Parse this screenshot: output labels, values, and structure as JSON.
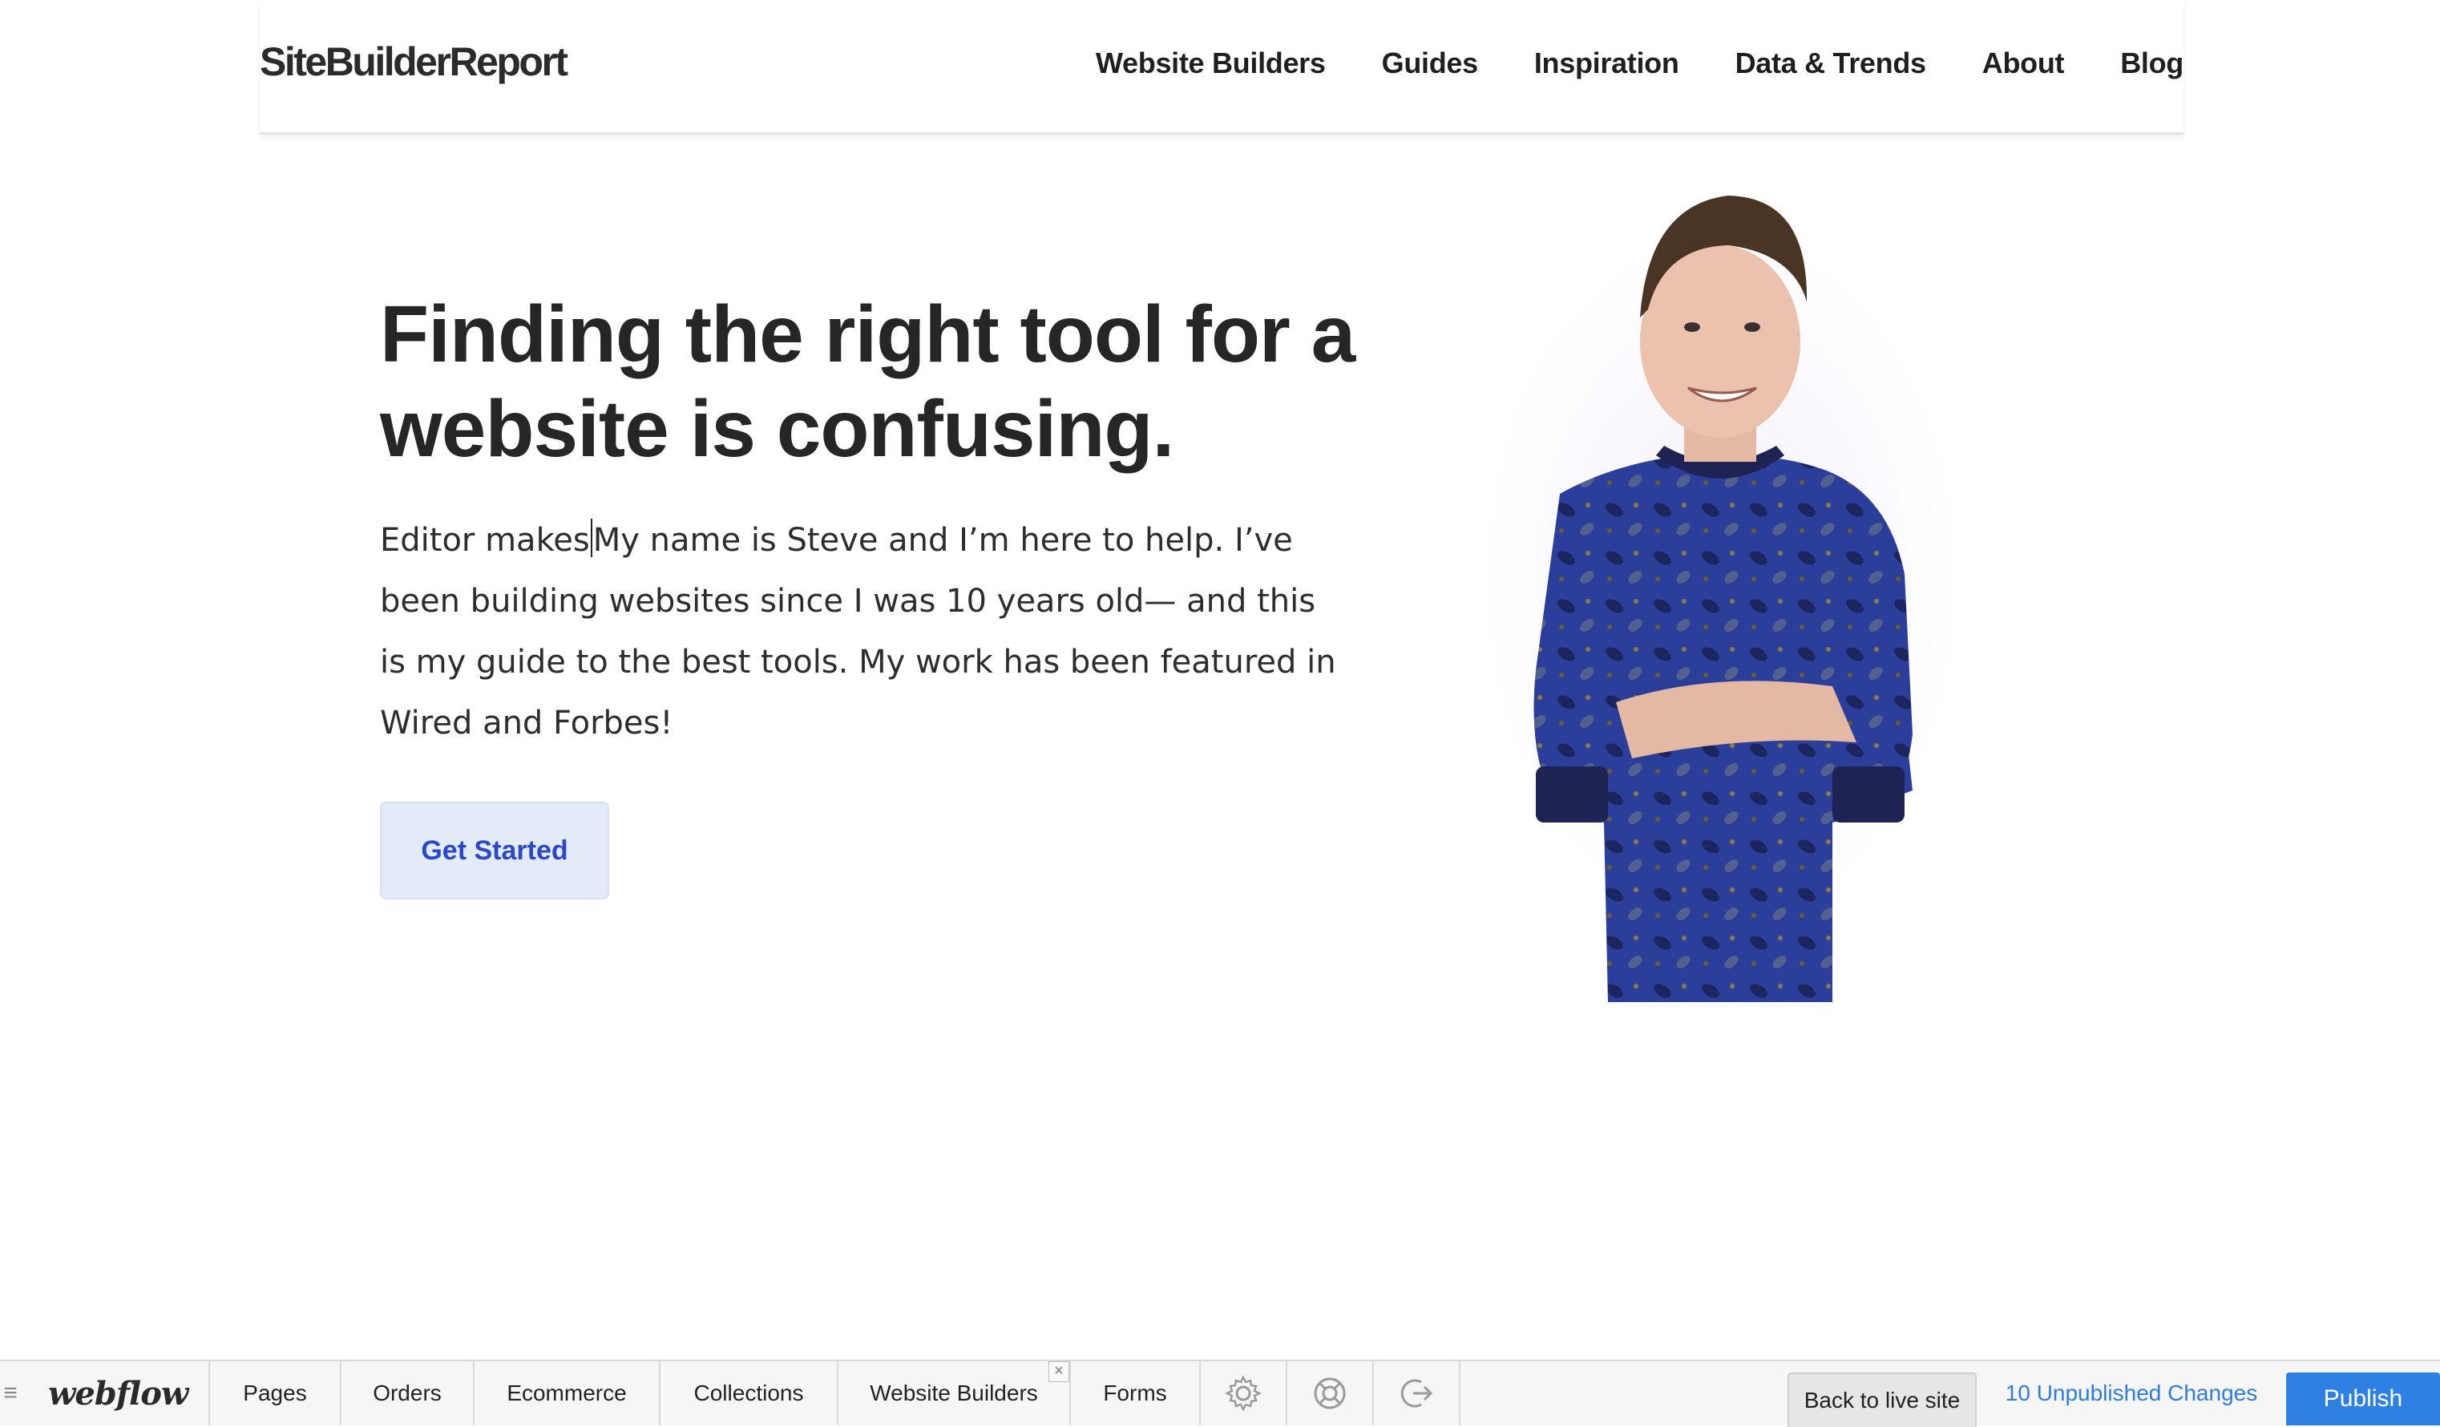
{
  "header": {
    "logo": "SiteBuilderReport",
    "nav": [
      {
        "label": "Website Builders"
      },
      {
        "label": "Guides"
      },
      {
        "label": "Inspiration"
      },
      {
        "label": "Data & Trends"
      },
      {
        "label": "About"
      },
      {
        "label": "Blog"
      }
    ]
  },
  "hero": {
    "title": "Finding the right tool for a website is confusing.",
    "body_prefix": "Editor makes",
    "body": "My name is Steve and I’m here to help. I’ve been building websites since I was 10 years old— and this is my guide to the best tools. My work has been featured in Wired and Forbes!",
    "cta_label": "Get Started"
  },
  "webflow_bar": {
    "logo": "webflow",
    "tabs": [
      {
        "label": "Pages"
      },
      {
        "label": "Orders"
      },
      {
        "label": "Ecommerce"
      },
      {
        "label": "Collections"
      },
      {
        "label": "Website Builders"
      },
      {
        "label": "Forms"
      }
    ],
    "icons": [
      "gear-icon",
      "help-lifebuoy-icon",
      "logout-icon"
    ],
    "back_label": "Back to live site",
    "unpublished_label": "10 Unpublished Changes",
    "publish_label": "Publish"
  },
  "colors": {
    "cta_bg": "#e3eaf8",
    "cta_text": "#2a48c8",
    "publish_bg": "#2f80e3",
    "unpublished_text": "#2d7be0"
  }
}
